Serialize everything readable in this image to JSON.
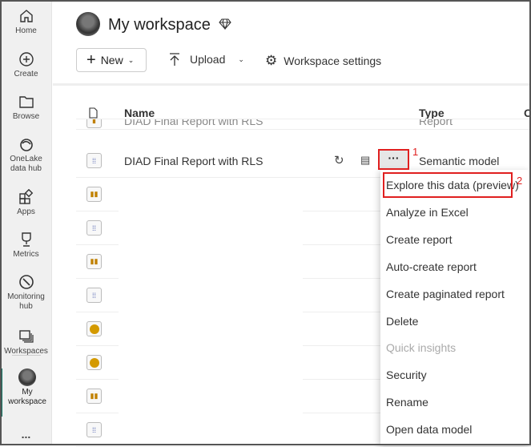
{
  "sidebar": {
    "items": [
      {
        "label": "Home"
      },
      {
        "label": "Create"
      },
      {
        "label": "Browse"
      },
      {
        "label": "OneLake",
        "label2": "data hub"
      },
      {
        "label": "Apps"
      },
      {
        "label": "Metrics"
      },
      {
        "label": "Monitoring",
        "label2": "hub"
      },
      {
        "label": "Workspaces"
      },
      {
        "label": "My",
        "label2": "workspace"
      }
    ],
    "more": "..."
  },
  "header": {
    "title": "My workspace"
  },
  "toolbar": {
    "new": "New",
    "upload": "Upload",
    "settings": "Workspace settings"
  },
  "table": {
    "columns": {
      "name": "Name",
      "type": "Type",
      "other": "O"
    },
    "rows": [
      {
        "name": "DIAD Final Report with RLS",
        "type": "Report",
        "icon": "report"
      },
      {
        "name": "DIAD Final Report with RLS",
        "type": "Semantic model",
        "icon": "semantic-model"
      }
    ],
    "more_icons": [
      "report",
      "semantic-model",
      "report",
      "semantic-model",
      "dashboard",
      "dashboard",
      "report",
      "semantic-model"
    ]
  },
  "row_actions": {
    "more": "···"
  },
  "context_menu": {
    "items": [
      "Explore this data (preview)",
      "Analyze in Excel",
      "Create report",
      "Auto-create report",
      "Create paginated report",
      "Delete",
      "Quick insights",
      "Security",
      "Rename",
      "Open data model"
    ],
    "disabled": [
      "Quick insights"
    ]
  },
  "annotations": {
    "step1": "1",
    "step2": "2"
  }
}
